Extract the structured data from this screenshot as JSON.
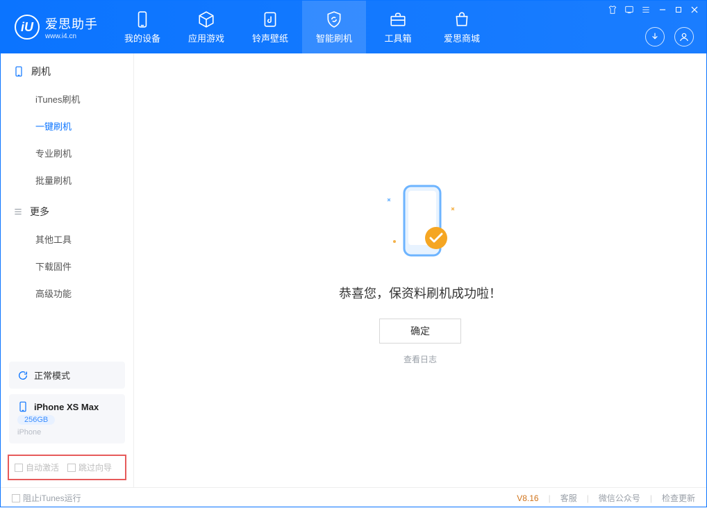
{
  "app": {
    "title": "爱思助手",
    "subtitle": "www.i4.cn"
  },
  "nav": {
    "items": [
      {
        "label": "我的设备"
      },
      {
        "label": "应用游戏"
      },
      {
        "label": "铃声壁纸"
      },
      {
        "label": "智能刷机"
      },
      {
        "label": "工具箱"
      },
      {
        "label": "爱思商城"
      }
    ]
  },
  "sidebar": {
    "section1": {
      "title": "刷机",
      "items": [
        "iTunes刷机",
        "一键刷机",
        "专业刷机",
        "批量刷机"
      ],
      "active_index": 1
    },
    "section2": {
      "title": "更多",
      "items": [
        "其他工具",
        "下载固件",
        "高级功能"
      ]
    },
    "mode": {
      "label": "正常模式"
    },
    "device": {
      "name": "iPhone XS Max",
      "capacity": "256GB",
      "type": "iPhone"
    },
    "options": {
      "opt1": "自动激活",
      "opt2": "跳过向导"
    }
  },
  "main": {
    "message": "恭喜您，保资料刷机成功啦！",
    "ok": "确定",
    "log_link": "查看日志"
  },
  "footer": {
    "block_itunes": "阻止iTunes运行",
    "version": "V8.16",
    "links": [
      "客服",
      "微信公众号",
      "检查更新"
    ]
  }
}
